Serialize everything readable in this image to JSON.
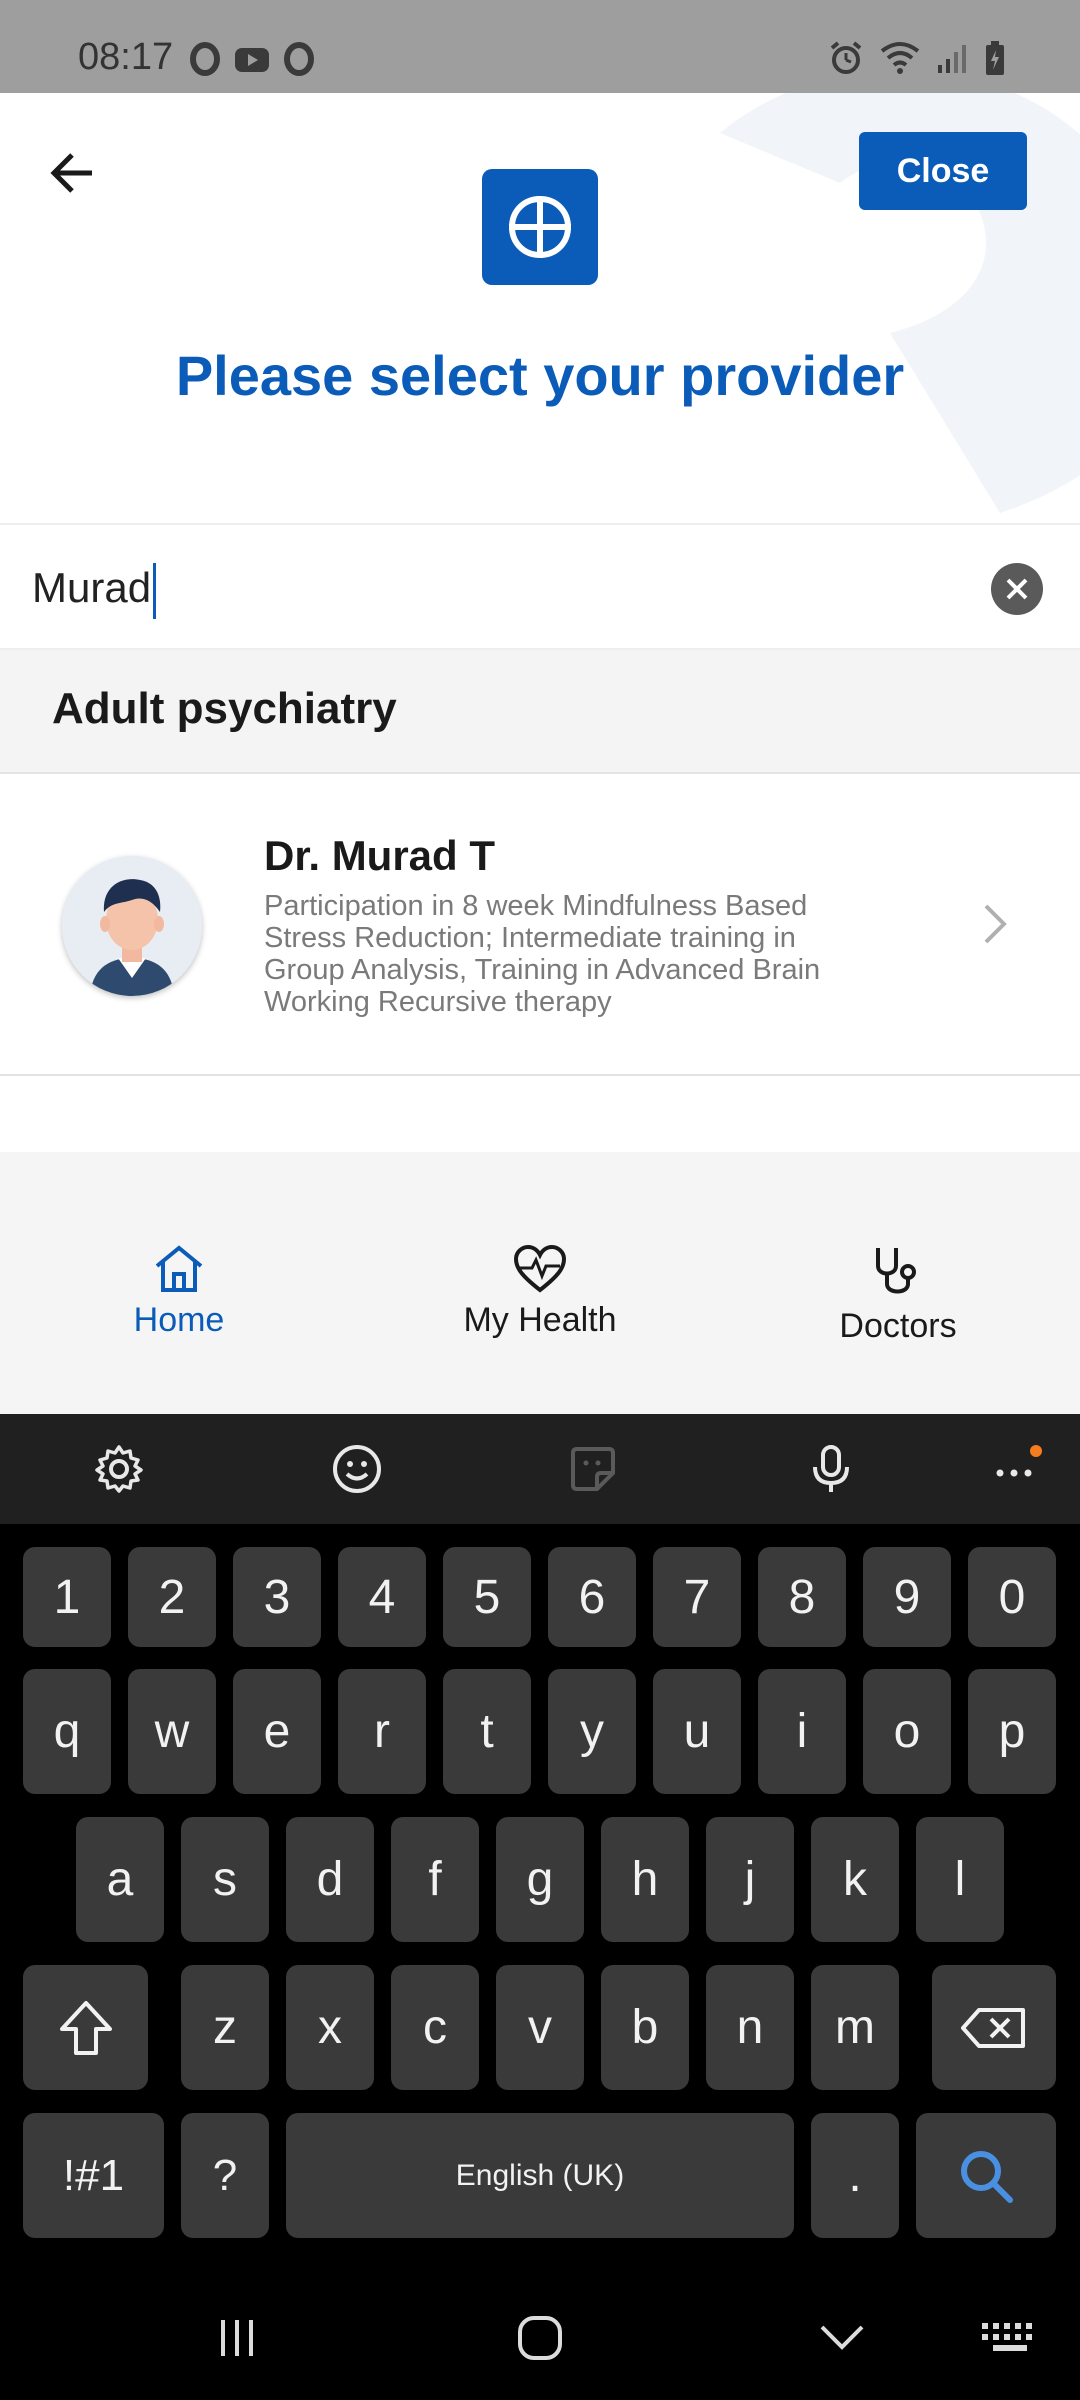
{
  "status_bar": {
    "time": "08:17"
  },
  "header": {
    "title": "Please select your provider",
    "close_label": "Close"
  },
  "search": {
    "value": "Murad"
  },
  "results": {
    "category": "Adult psychiatry",
    "providers": [
      {
        "name": "Dr. Murad T",
        "description_lines": [
          "Participation in 8 week Mindfulness Based",
          "Stress Reduction; Intermediate training in",
          "Group Analysis, Training in Advanced Brain",
          "Working Recursive therapy"
        ]
      }
    ]
  },
  "bottom_nav": {
    "items": [
      {
        "label": "Home",
        "icon": "home-icon",
        "active": true
      },
      {
        "label": "My Health",
        "icon": "heart-pulse-icon",
        "active": false
      },
      {
        "label": "Doctors",
        "icon": "stethoscope-icon",
        "active": false
      }
    ]
  },
  "keyboard": {
    "number_row": [
      "1",
      "2",
      "3",
      "4",
      "5",
      "6",
      "7",
      "8",
      "9",
      "0"
    ],
    "row1": [
      "q",
      "w",
      "e",
      "r",
      "t",
      "y",
      "u",
      "i",
      "o",
      "p"
    ],
    "row2": [
      "a",
      "s",
      "d",
      "f",
      "g",
      "h",
      "j",
      "k",
      "l"
    ],
    "row3": [
      "z",
      "x",
      "c",
      "v",
      "b",
      "n",
      "m"
    ],
    "symbols_label": "!#1",
    "question_label": "?",
    "space_label": "English (UK)",
    "period_label": "."
  },
  "colors": {
    "brand_blue": "#0b5cb8",
    "search_key_blue": "#4a90e2",
    "notification_dot": "#f57c1f"
  }
}
